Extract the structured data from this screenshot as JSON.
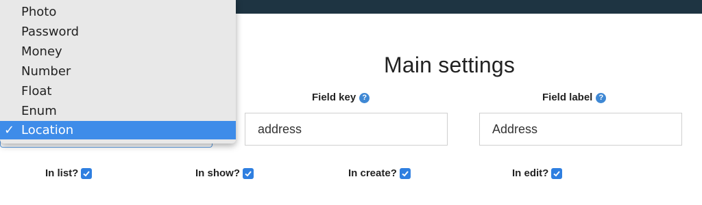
{
  "page": {
    "title": "Main settings"
  },
  "fields": {
    "key": {
      "label": "Field key",
      "value": "address"
    },
    "label": {
      "label": "Field label",
      "value": "Address"
    }
  },
  "help_icon": "?",
  "dropdown": {
    "items": [
      "Photo",
      "Password",
      "Money",
      "Number",
      "Float",
      "Enum",
      "Location"
    ],
    "selected": "Location",
    "check_mark": "✓"
  },
  "checkboxes": [
    {
      "label": "In list?",
      "checked": true
    },
    {
      "label": "In show?",
      "checked": true
    },
    {
      "label": "In create?",
      "checked": true
    },
    {
      "label": "In edit?",
      "checked": true
    }
  ],
  "colors": {
    "topbar": "#1e3442",
    "accent": "#3e8ce9",
    "help": "#3f88d4"
  }
}
